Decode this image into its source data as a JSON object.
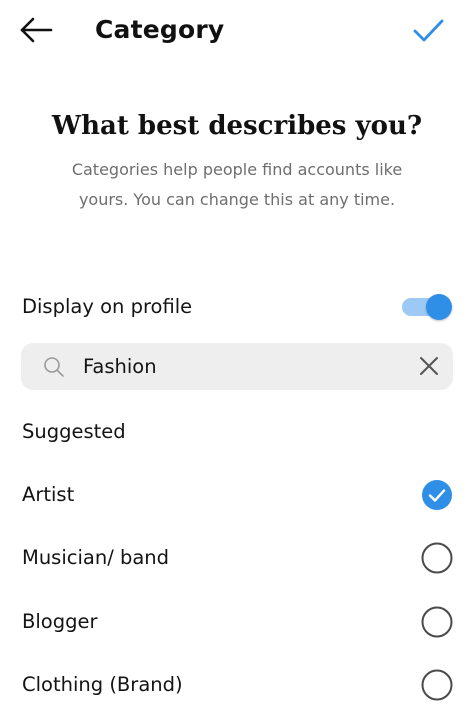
{
  "header": {
    "title": "Category",
    "back_icon": "arrow-left-icon",
    "done_icon": "checkmark-icon",
    "accent_color": "#2f8ee6"
  },
  "intro": {
    "heading": "What best describes you?",
    "subtext_line1": "Categories help people find accounts like",
    "subtext_line2": "yours. You can change this at any time."
  },
  "display_toggle": {
    "label": "Display on profile",
    "on": true
  },
  "search": {
    "value": "Fashion",
    "icon": "search-icon",
    "clear_icon": "close-icon"
  },
  "suggested": {
    "label": "Suggested",
    "options": [
      {
        "label": "Artist",
        "selected": true
      },
      {
        "label": "Musician/ band",
        "selected": false
      },
      {
        "label": "Blogger",
        "selected": false
      },
      {
        "label": "Clothing (Brand)",
        "selected": false
      }
    ]
  }
}
